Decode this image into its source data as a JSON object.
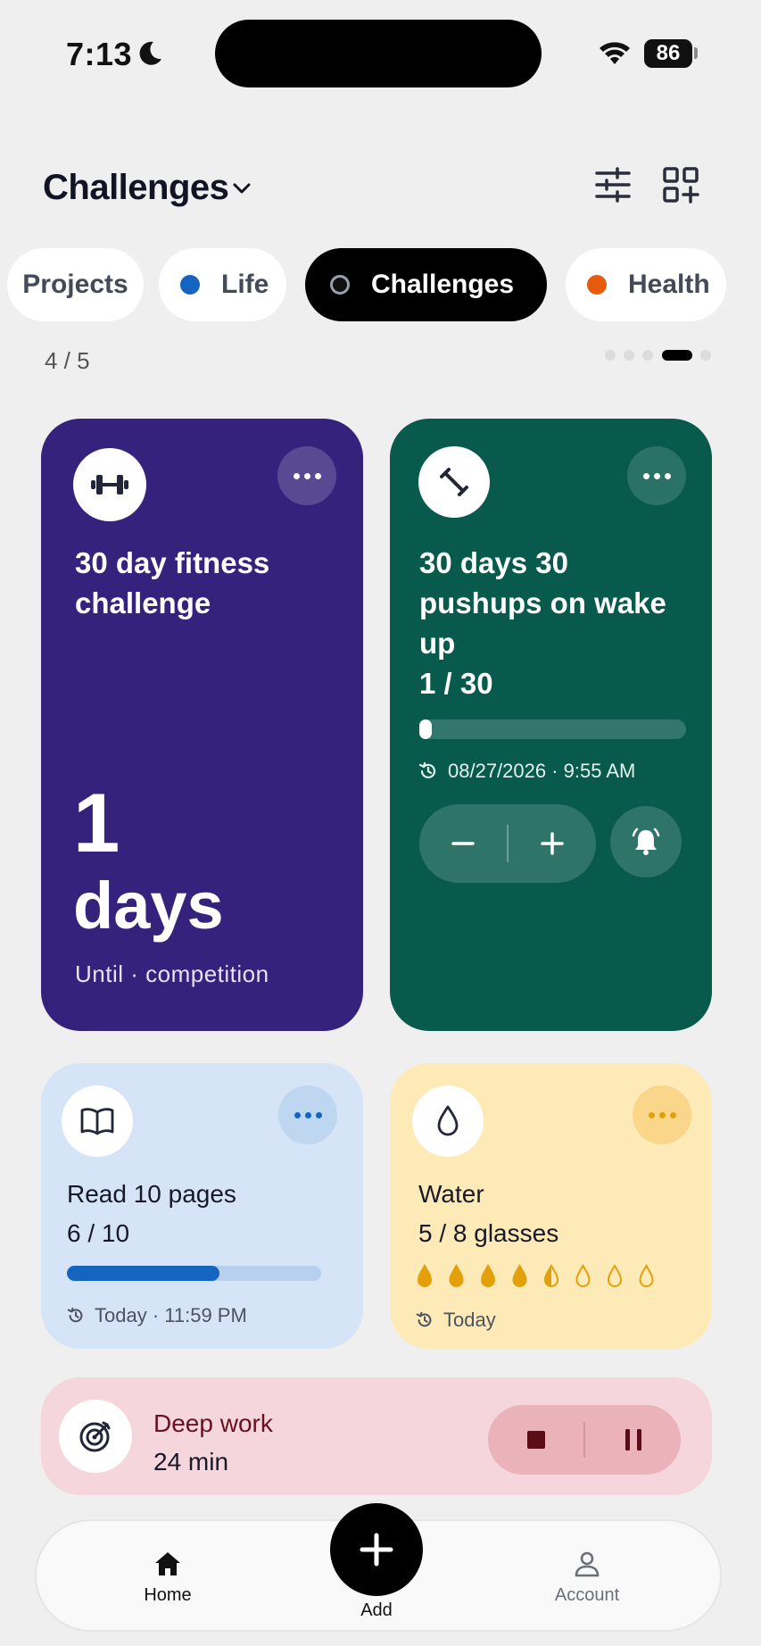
{
  "status_bar": {
    "time": "7:13",
    "battery": "86"
  },
  "header": {
    "title": "Challenges"
  },
  "tabs": [
    {
      "label": "Projects",
      "active": false
    },
    {
      "label": "Life",
      "active": false,
      "color": "#1565c0"
    },
    {
      "label": "Challenges",
      "active": true,
      "color": "#111111"
    },
    {
      "label": "Health",
      "active": false,
      "color": "#e65c0c"
    }
  ],
  "pager": {
    "text": "4 / 5",
    "current": 4,
    "total": 5
  },
  "cards": {
    "fitness": {
      "icon": "dumbbell-icon",
      "title_line1": "30 day fitness",
      "title_line2": "challenge",
      "count": "1",
      "unit": "days",
      "subtitle": "Until · competition",
      "color": "#35227c"
    },
    "pushups": {
      "icon": "exercise-icon",
      "title_line1": "30 days 30",
      "title_line2": "pushups on wake",
      "title_line3": "up",
      "progress_text": "1 / 30",
      "progress": 0.033,
      "timestamp": "08/27/2026 · 9:55 AM",
      "color": "#075a4c"
    },
    "read": {
      "icon": "book-icon",
      "title": "Read 10 pages",
      "progress_text": "6 / 10",
      "progress": 0.6,
      "timestamp": "Today · 11:59 PM",
      "color": "#d5e5f7",
      "accent": "#1565c0"
    },
    "water": {
      "icon": "water-drop-icon",
      "title": "Water",
      "progress_text": "5 / 8 glasses",
      "glasses_filled": 4.5,
      "glasses_total": 8,
      "timestamp": "Today",
      "color": "#fdeab7",
      "accent": "#e3a008"
    },
    "deep_work": {
      "icon": "target-icon",
      "title": "Deep work",
      "duration": "24 min",
      "color": "#f4d6dc"
    }
  },
  "bottom_nav": {
    "home": "Home",
    "add": "Add",
    "account": "Account"
  }
}
